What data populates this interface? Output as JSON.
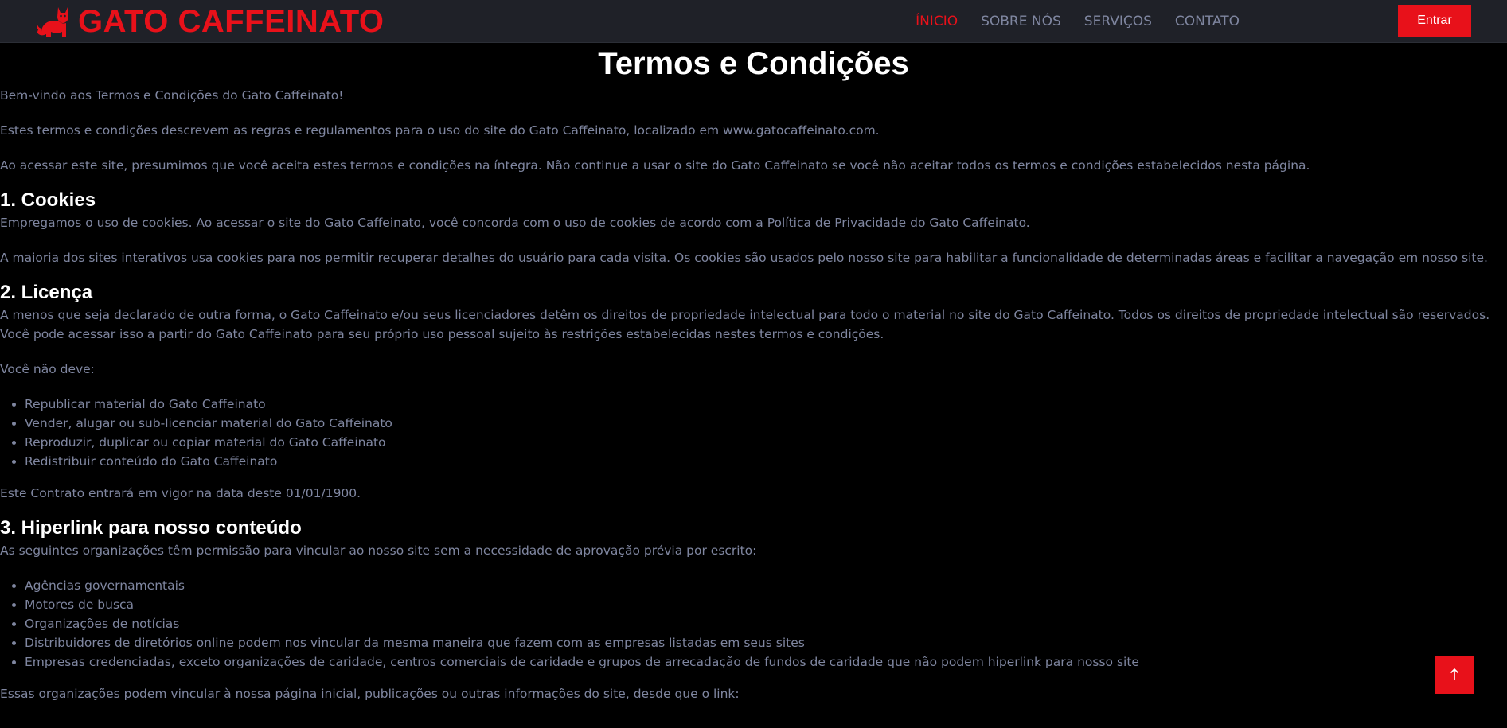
{
  "header": {
    "brand": "GATO CAFFEINATO",
    "nav": [
      {
        "label": "ÍNICIO"
      },
      {
        "label": "SOBRE NÓS"
      },
      {
        "label": "SERVIÇOS"
      },
      {
        "label": "CONTATO"
      }
    ],
    "login_label": "Entrar"
  },
  "page": {
    "title": "Termos e Condições",
    "intro": [
      "Bem-vindo aos Termos e Condições do Gato Caffeinato!",
      "Estes termos e condições descrevem as regras e regulamentos para o uso do site do Gato Caffeinato, localizado em www.gatocaffeinato.com.",
      "Ao acessar este site, presumimos que você aceita estes termos e condições na íntegra. Não continue a usar o site do Gato Caffeinato se você não aceitar todos os termos e condições estabelecidos nesta página."
    ],
    "section1": {
      "heading": "1. Cookies",
      "p1": "Empregamos o uso de cookies. Ao acessar o site do Gato Caffeinato, você concorda com o uso de cookies de acordo com a Política de Privacidade do Gato Caffeinato.",
      "p2": "A maioria dos sites interativos usa cookies para nos permitir recuperar detalhes do usuário para cada visita. Os cookies são usados pelo nosso site para habilitar a funcionalidade de determinadas áreas e facilitar a navegação em nosso site."
    },
    "section2": {
      "heading": "2. Licença",
      "p1": "A menos que seja declarado de outra forma, o Gato Caffeinato e/ou seus licenciadores detêm os direitos de propriedade intelectual para todo o material no site do Gato Caffeinato. Todos os direitos de propriedade intelectual são reservados. Você pode acessar isso a partir do Gato Caffeinato para seu próprio uso pessoal sujeito às restrições estabelecidas nestes termos e condições.",
      "p2": "Você não deve:",
      "items": [
        "Republicar material do Gato Caffeinato",
        "Vender, alugar ou sub-licenciar material do Gato Caffeinato",
        "Reproduzir, duplicar ou copiar material do Gato Caffeinato",
        "Redistribuir conteúdo do Gato Caffeinato"
      ],
      "p3": "Este Contrato entrará em vigor na data deste 01/01/1900."
    },
    "section3": {
      "heading": "3. Hiperlink para nosso conteúdo",
      "p1": "As seguintes organizações têm permissão para vincular ao nosso site sem a necessidade de aprovação prévia por escrito:",
      "items": [
        "Agências governamentais",
        "Motores de busca",
        "Organizações de notícias",
        "Distribuidores de diretórios online podem nos vincular da mesma maneira que fazem com as empresas listadas em seus sites",
        "Empresas credenciadas, exceto organizações de caridade, centros comerciais de caridade e grupos de arrecadação de fundos de caridade que não podem hiperlink para nosso site"
      ],
      "p2": "Essas organizações podem vincular à nossa página inicial, publicações ou outras informações do site, desde que o link:"
    }
  },
  "back_to_top_icon": "arrow-up-icon",
  "colors": {
    "accent": "#e8111a",
    "navbar_bg": "#1f2128",
    "text_muted": "#7f86a0",
    "heading": "#ffffff",
    "page_bg": "#000000"
  }
}
